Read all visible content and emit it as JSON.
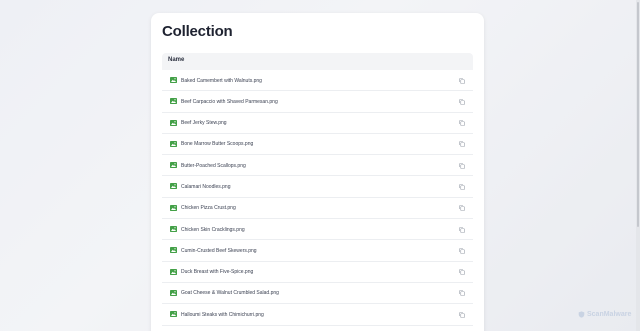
{
  "page": {
    "title": "Collection"
  },
  "table": {
    "column_name": "Name",
    "rows": [
      {
        "name": "Baked Camembert with Walnuts.png"
      },
      {
        "name": "Beef Carpaccio with Shaved Parmesan.png"
      },
      {
        "name": "Beef Jerky Stew.png"
      },
      {
        "name": "Bone Marrow Butter Scoops.png"
      },
      {
        "name": "Butter-Poached Scallops.png"
      },
      {
        "name": "Calamari Noodles.png"
      },
      {
        "name": "Chicken Pizza Crust.png"
      },
      {
        "name": "Chicken Skin Cracklings.png"
      },
      {
        "name": "Cumin-Crusted Beef Skewers.png"
      },
      {
        "name": "Duck Breast with Five-Spice.png"
      },
      {
        "name": "Goat Cheese & Walnut Crumbled Salad.png"
      },
      {
        "name": "Halloumi Steaks with Chimichurri.png"
      }
    ]
  },
  "icons": {
    "file": "image-file-icon",
    "copy": "copy-icon"
  },
  "colors": {
    "image_icon": "#43a047",
    "copy_icon": "#9aa0aa"
  },
  "watermark": {
    "text": "ScanMalware"
  }
}
